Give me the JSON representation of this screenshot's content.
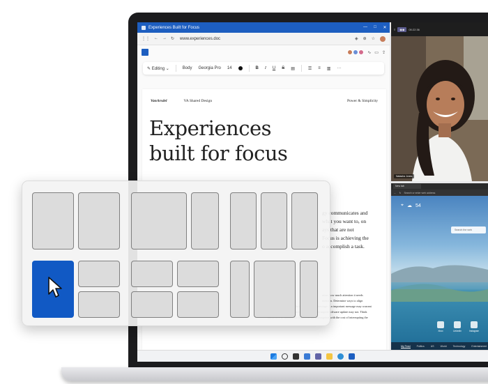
{
  "word": {
    "window_title": "Experiences Built for Focus",
    "url": "www.experiences.doc",
    "toolbar": {
      "editing": "Editing",
      "style": "Body",
      "font": "Georgia Pro",
      "size": "14",
      "bold": "B",
      "italic": "I",
      "underline": "U",
      "strike": "S"
    },
    "doc": {
      "brand": "VanArsdel",
      "shared": "VA Shared Design",
      "tagline": "Power & Simplicity",
      "title_line1": "Experiences",
      "title_line2": "built for focus",
      "body": [
        "gy communicates and",
        "what you want to, on",
        "ays that are not",
        "Focus is achieving the",
        "o accomplish a task."
      ],
      "small": [
        "mise, how much attention it needs",
        "ntention. Determine ways to align",
        "the delivery time with the urgency of the message. An important message may warrant",
        "taking full attention from the person. A non-urgent software update may not. Think",
        "about how to balance the benefit of the interruption with the cost of interrupting the"
      ]
    }
  },
  "video": {
    "time": "05:22:36",
    "participant": "Natasha Jones"
  },
  "edge": {
    "tab_label": "New tab",
    "address_placeholder": "Search or enter web address",
    "temperature": "54",
    "search_placeholder": "Search the web",
    "tiles": [
      "Xbox",
      "LinkedIn",
      "Instagram"
    ],
    "feed": [
      "My Feed",
      "Politics",
      "US",
      "World",
      "Technology",
      "Entertainment"
    ]
  },
  "colors": {
    "word_blue": "#1d5ec0",
    "snap_active": "#1159c4"
  }
}
